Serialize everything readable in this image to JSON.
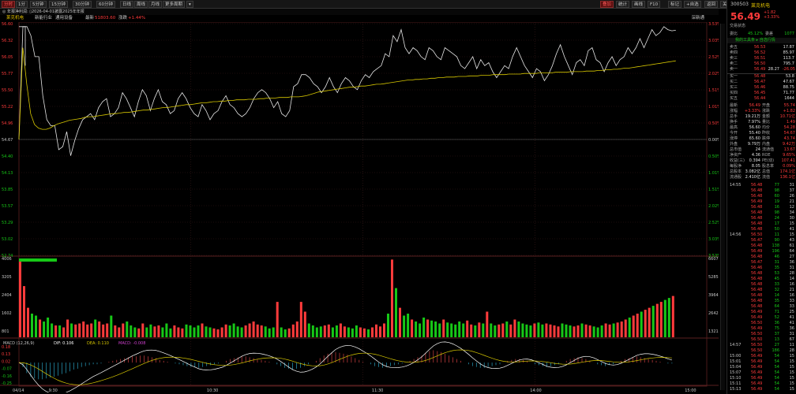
{
  "toolbar": {
    "left": [
      "分时",
      "1分",
      "5分钟",
      "15分钟",
      "30分钟",
      "60分钟",
      "日线",
      "周线",
      "月线",
      "更多周期",
      "▾"
    ],
    "right": [
      "叠加",
      "统计",
      "画线",
      "F10",
      "标记",
      "+自选",
      "返回",
      "关注",
      "经典",
      "指标"
    ],
    "active_right": "叠加"
  },
  "infobar": {
    "text": "◎  年报净利润: ▯2026-04-01披露2025年年报"
  },
  "legend": {
    "name": "莱克机电",
    "industry": "新能行业",
    "ind_extra": "通用设备",
    "latest_label": "最新",
    "latest": "51803.60",
    "change_label": "涨跌",
    "change": "+1.44%",
    "right_label": "深新通"
  },
  "colors": {
    "up": "#ff3b3b",
    "down": "#17c817",
    "price_line": "#e6e6e6",
    "avg_line": "#d8c800",
    "dif_line": "#ffffff",
    "dea_line": "#d8c800",
    "macd_up": "#d04040",
    "macd_down": "#28a0c0",
    "grid": "#3a1a1a"
  },
  "chart_data": [
    {
      "type": "line",
      "title": "",
      "y_left_ticks": [
        "56.60",
        "56.32",
        "56.05",
        "55.77",
        "55.50",
        "55.22",
        "54.96",
        "54.67",
        "54.40",
        "54.13",
        "53.85",
        "53.57",
        "53.29",
        "53.02",
        "52.74"
      ],
      "y_right_ticks": [
        "3.53%",
        "3.03%",
        "2.52%",
        "2.02%",
        "1.51%",
        "1.01%",
        "0.50%",
        "0.00%",
        "0.50%",
        "1.01%",
        "1.51%",
        "2.02%",
        "2.52%",
        "3.03%",
        "3.53%"
      ],
      "ylim": [
        52.74,
        56.6
      ],
      "prev_close": 54.67,
      "x_ticks": [
        "04/14",
        "9:30",
        "10:30",
        "11:30",
        "14:00",
        "15:00"
      ],
      "series": [
        {
          "name": "",
          "x_end_of_day_fraction": true,
          "values": [
            54.67,
            56.55,
            56.55,
            56.4,
            56.05,
            56.05,
            55.4,
            55.0,
            54.9,
            54.9,
            54.5,
            54.55,
            54.8,
            54.4,
            54.65,
            54.85,
            55.0,
            55.05,
            55.1,
            55.0,
            55.2,
            55.3,
            55.35,
            55.05,
            55.1,
            55.2,
            55.45,
            55.35,
            55.2,
            55.05,
            55.3,
            55.5,
            55.4,
            55.15,
            55.35,
            55.5,
            55.3,
            55.25,
            55.1,
            55.15,
            55.35,
            55.45,
            55.35,
            55.2,
            55.1,
            55.05,
            55.25,
            55.15,
            55.0,
            55.1,
            55.15,
            55.3,
            55.4,
            55.25,
            55.2,
            55.1,
            55.05,
            55.1,
            55.2,
            55.35,
            55.45,
            55.5,
            55.45,
            55.35,
            55.2,
            55.3,
            55.1,
            55.05,
            55.15,
            55.55,
            55.6,
            55.75,
            55.75,
            55.7,
            55.6,
            55.55,
            55.45,
            55.55,
            55.7,
            55.55,
            55.45,
            55.6,
            55.7,
            55.65,
            55.55,
            55.5,
            55.65,
            55.75,
            55.7,
            55.8,
            55.85,
            55.9,
            56.1,
            56.05,
            56.4,
            56.3,
            56.5,
            56.2,
            56.1,
            56.2,
            56.15,
            56.05,
            56.0,
            56.2,
            56.15,
            56.05,
            56.0,
            56.2,
            56.15,
            56.1,
            56.05,
            55.9,
            55.85,
            55.95,
            56.05,
            55.85,
            56.0,
            55.9,
            55.95,
            55.8,
            55.7,
            55.8,
            55.9,
            55.85,
            56.05,
            56.2,
            56.05,
            55.9,
            55.8,
            55.7,
            55.85,
            55.8,
            55.65,
            55.75,
            55.9,
            56.1,
            56.25,
            56.05,
            55.9,
            55.75,
            55.95,
            56.0,
            55.9,
            56.15,
            56.2,
            56.0,
            55.95,
            55.8,
            55.95,
            56.05,
            55.9,
            56.0,
            56.05,
            56.2,
            56.1,
            56.2,
            56.35,
            56.2,
            56.35,
            56.5,
            56.4,
            56.45,
            56.55,
            56.5,
            56.48,
            56.49
          ]
        },
        {
          "name": "",
          "values": [
            54.67,
            56.2,
            55.6,
            55.1,
            54.92,
            54.86,
            54.84,
            54.84,
            54.86,
            54.9,
            54.93,
            54.95,
            54.97,
            54.99,
            55.0,
            55.01,
            55.02,
            55.04,
            55.05,
            55.05,
            55.06,
            55.07,
            55.08,
            55.09,
            55.1,
            55.1,
            55.11,
            55.12,
            55.12,
            55.13,
            55.14,
            55.15,
            55.16,
            55.16,
            55.17,
            55.18,
            55.19,
            55.2,
            55.2,
            55.21,
            55.22,
            55.23,
            55.24,
            55.25,
            55.25,
            55.26,
            55.27,
            55.28,
            55.28,
            55.29,
            55.3,
            55.3,
            55.31,
            55.31,
            55.32,
            55.32,
            55.33,
            55.33,
            55.33,
            55.34,
            55.34,
            55.34,
            55.35,
            55.35,
            55.36,
            55.36,
            55.36,
            55.37,
            55.37,
            55.37,
            55.38,
            55.38,
            55.38,
            55.39,
            55.4,
            55.42,
            55.44,
            55.46,
            55.47,
            55.48,
            55.49,
            55.5,
            55.51,
            55.52,
            55.53,
            55.54,
            55.54,
            55.55,
            55.56,
            55.56,
            55.57,
            55.58,
            55.59,
            55.59,
            55.6,
            55.61,
            55.62,
            55.63,
            55.64,
            55.65,
            55.66,
            55.66,
            55.67,
            55.67,
            55.68,
            55.68,
            55.69,
            55.69,
            55.7,
            55.7,
            55.71,
            55.71,
            55.71,
            55.72,
            55.72,
            55.72,
            55.73,
            55.73,
            55.73,
            55.74,
            55.74,
            55.74,
            55.75,
            55.75,
            55.75,
            55.75,
            55.76,
            55.76,
            55.76,
            55.76,
            55.77,
            55.77,
            55.77,
            55.77,
            55.78,
            55.78,
            55.78,
            55.78,
            55.79,
            55.79,
            55.79,
            55.79,
            55.8,
            55.8,
            55.8,
            55.8,
            55.81,
            55.81,
            55.81,
            55.82,
            55.82,
            55.83,
            55.83,
            55.84,
            55.84,
            55.85,
            55.86,
            55.86,
            55.87,
            55.88,
            55.89,
            55.9,
            55.91,
            55.92,
            55.93,
            55.94,
            55.95,
            55.96,
            55.97,
            55.98
          ]
        }
      ]
    },
    {
      "type": "bar",
      "title": "",
      "y_left_ticks": [
        "4006",
        "3205",
        "2404",
        "1602",
        "801"
      ],
      "y_right_ticks": [
        "6607",
        "5285",
        "3964",
        "2642",
        "1321"
      ],
      "ylim": [
        0,
        4006
      ],
      "volume_bars": [
        4006,
        2600,
        1500,
        1200,
        1100,
        900,
        800,
        1000,
        700,
        600,
        600,
        500,
        900,
        700,
        650,
        700,
        800,
        650,
        700,
        900,
        800,
        650,
        700,
        1100,
        600,
        500,
        700,
        800,
        600,
        500,
        450,
        700,
        500,
        650,
        550,
        600,
        500,
        700,
        450,
        600,
        500,
        450,
        650,
        600,
        500,
        600,
        700,
        550,
        500,
        450,
        400,
        500,
        650,
        600,
        700,
        550,
        500,
        600,
        700,
        800,
        650,
        600,
        550,
        450,
        500,
        1800,
        500,
        400,
        450,
        650,
        800,
        1800,
        1300,
        700,
        600,
        500,
        550,
        600,
        650,
        500,
        600,
        700,
        550,
        500,
        450,
        600,
        500,
        450,
        400,
        500,
        650,
        550,
        700,
        1200,
        3950,
        2500,
        1500,
        1100,
        1200,
        900,
        800,
        700,
        1000,
        900,
        850,
        800,
        700,
        900,
        750,
        700,
        650,
        800,
        700,
        850,
        650,
        600,
        750,
        700,
        1300,
        700,
        600,
        650,
        700,
        800,
        650,
        900,
        800,
        700,
        650,
        600,
        700,
        750,
        650,
        700,
        650,
        600,
        550,
        700,
        650,
        600,
        550,
        600,
        700,
        650,
        600,
        550,
        500,
        600,
        700,
        650,
        700,
        750,
        800,
        900,
        1000,
        1100,
        1200,
        1300,
        1400,
        1500,
        1600,
        1700,
        1800,
        1900,
        2000,
        2100
      ]
    },
    {
      "type": "bar",
      "title": "MACD (12,26,9)",
      "labels": {
        "dif": "DIF: 0.106",
        "dea": "DEA: 0.110",
        "macd": "MACD: -0.008"
      },
      "y_left_ticks": [
        "0.18",
        "0.13",
        "0.02",
        "-0.07",
        "-0.16",
        "-0.25"
      ],
      "ylim": [
        -0.25,
        0.18
      ],
      "macd_values": [
        0.0,
        -0.05,
        -0.12,
        -0.16,
        -0.18,
        -0.19,
        -0.19,
        -0.18,
        -0.17,
        -0.16,
        -0.15,
        -0.13,
        -0.12,
        -0.1,
        -0.08,
        -0.07,
        -0.05,
        -0.04,
        -0.03,
        -0.02,
        -0.02,
        -0.01,
        0.0,
        0.01,
        0.02,
        0.03,
        0.04,
        0.05,
        0.06,
        0.07,
        0.07,
        0.08,
        0.08,
        0.07,
        0.06,
        0.05,
        0.03,
        0.02,
        0.01,
        0.0,
        -0.01,
        -0.02,
        -0.03,
        -0.04,
        -0.05,
        -0.05,
        -0.06,
        -0.05,
        -0.04,
        -0.03,
        -0.02,
        -0.01,
        0.0,
        0.02,
        0.04,
        0.05,
        0.06,
        0.07,
        0.07,
        0.06,
        0.05,
        0.04,
        0.03,
        0.02,
        0.01,
        0.0,
        -0.02,
        -0.04,
        -0.06,
        -0.07,
        -0.08,
        -0.07,
        -0.06,
        -0.04,
        -0.02,
        0.0,
        0.02,
        0.05,
        0.08,
        0.1,
        0.11,
        0.12,
        0.11,
        0.1,
        0.09,
        0.07,
        0.05,
        0.03,
        0.01,
        0.0,
        -0.02,
        -0.04,
        -0.05,
        -0.06,
        -0.05,
        -0.04,
        -0.03,
        -0.02,
        -0.01,
        0.0,
        0.02,
        0.04,
        0.06,
        0.08,
        0.11,
        0.13,
        0.14,
        0.13,
        0.12,
        0.1,
        0.08,
        0.06,
        0.04,
        0.02,
        0.0,
        -0.02,
        -0.04,
        -0.05,
        -0.06,
        -0.06,
        -0.05,
        -0.04,
        -0.03,
        -0.02,
        0.0,
        0.02,
        0.03,
        0.04,
        0.04,
        0.03,
        0.02,
        0.0,
        -0.02,
        -0.03,
        -0.04,
        -0.05,
        -0.04,
        -0.03,
        -0.02,
        0.0,
        0.02,
        0.04,
        0.05,
        0.06,
        0.05,
        0.04,
        0.02,
        0.0,
        -0.02,
        -0.03,
        -0.04,
        -0.03,
        -0.02,
        0.0,
        0.02,
        0.04,
        0.05,
        0.06,
        0.07,
        0.06,
        0.05,
        0.04,
        0.03,
        0.02,
        0.01,
        0.0,
        -0.01,
        -0.01
      ]
    }
  ],
  "sidebar": {
    "code": "300503",
    "name": "莱克机电",
    "price": "56.49",
    "change": "+1.82",
    "change_pct": "+3.33%",
    "section_title": "交易状态",
    "ratio_label": "委比",
    "ratio_val": "45.12%",
    "diff_label": "委差",
    "diff_val": "1077",
    "quote_title": "我的工具条 ▸ 自选行情",
    "asks": [
      {
        "l": "卖五",
        "p": "56.53",
        "v": "17.87"
      },
      {
        "l": "卖四",
        "p": "56.52",
        "v": "85.97"
      },
      {
        "l": "卖三",
        "p": "56.51",
        "v": "113.7"
      },
      {
        "l": "卖二",
        "p": "56.50",
        "v": "795.7"
      },
      {
        "l": "卖一",
        "p": "56.49",
        "v": "28.27",
        "x": "-26.05"
      }
    ],
    "bids": [
      {
        "l": "买一",
        "p": "56.48",
        "v": "53.8"
      },
      {
        "l": "买二",
        "p": "56.47",
        "v": "47.67"
      },
      {
        "l": "买三",
        "p": "56.46",
        "v": "88.75"
      },
      {
        "l": "买四",
        "p": "56.45",
        "v": "71.77"
      },
      {
        "l": "买五",
        "p": "56.44",
        "v": "1644"
      }
    ],
    "stats": [
      {
        "a": "最新",
        "av": "56.49",
        "b": "开盘",
        "bv": "55.74"
      },
      {
        "a": "涨幅",
        "av": "+3.33%",
        "b": "涨跌",
        "bv": "+1.82"
      },
      {
        "a": "总手",
        "av": "19.21万",
        "b": "金额",
        "bv": "10.71亿"
      },
      {
        "a": "换手",
        "av": "7.97%",
        "b": "量比",
        "bv": "1.49"
      },
      {
        "a": "最高",
        "av": "56.60",
        "b": "均价",
        "bv": "54.28"
      },
      {
        "a": "今开",
        "av": "55.40",
        "b": "昨收",
        "bv": "54.67"
      },
      {
        "a": "涨停",
        "av": "65.60",
        "b": "跌停",
        "bv": "43.74"
      },
      {
        "a": "外盘",
        "av": "9.79万",
        "b": "内盘",
        "bv": "9.42万"
      },
      {
        "a": "总市值",
        "av": "24",
        "b": "流通值",
        "bv": "13.67"
      },
      {
        "a": "净资产",
        "av": "4.36",
        "b": "ROE",
        "bv": "9.65%"
      },
      {
        "a": "收益(三)",
        "av": "0.394",
        "b": "PE(动)",
        "bv": "107.41"
      },
      {
        "a": "每股净",
        "av": "8.05",
        "b": "股息率",
        "bv": "0.09%"
      },
      {
        "a": "总股本",
        "av": "3.082亿",
        "b": "总值",
        "bv": "174.1亿"
      },
      {
        "a": "流通股",
        "av": "2.410亿",
        "b": "流值",
        "bv": "136.1亿"
      }
    ],
    "ticks": [
      {
        "t": "14:55",
        "p": "56.48",
        "v": "77",
        "d": "31"
      },
      {
        "t": "",
        "p": "56.48",
        "v": "98",
        "d": "37"
      },
      {
        "t": "",
        "p": "56.48",
        "v": "60",
        "d": "26"
      },
      {
        "t": "",
        "p": "56.49",
        "v": "19",
        "d": "21"
      },
      {
        "t": "",
        "p": "56.48",
        "v": "16",
        "d": "12"
      },
      {
        "t": "",
        "p": "56.48",
        "v": "98",
        "d": "34"
      },
      {
        "t": "",
        "p": "56.48",
        "v": "24",
        "d": "30"
      },
      {
        "t": "",
        "p": "56.48",
        "v": "17",
        "d": "15"
      },
      {
        "t": "",
        "p": "56.48",
        "v": "50",
        "d": "41"
      },
      {
        "t": "14:56",
        "p": "56.50",
        "v": "11",
        "d": "15"
      },
      {
        "t": "",
        "p": "56.47",
        "v": "90",
        "d": "43"
      },
      {
        "t": "",
        "p": "56.48",
        "v": "138",
        "d": "61"
      },
      {
        "t": "",
        "p": "56.49",
        "v": "196",
        "d": "64"
      },
      {
        "t": "",
        "p": "56.48",
        "v": "46",
        "d": "27"
      },
      {
        "t": "",
        "p": "56.47",
        "v": "31",
        "d": "36"
      },
      {
        "t": "",
        "p": "56.46",
        "v": "35",
        "d": "31"
      },
      {
        "t": "",
        "p": "56.48",
        "v": "53",
        "d": "28"
      },
      {
        "t": "",
        "p": "56.48",
        "v": "45",
        "d": "14"
      },
      {
        "t": "",
        "p": "56.48",
        "v": "33",
        "d": "16"
      },
      {
        "t": "",
        "p": "56.48",
        "v": "32",
        "d": "21"
      },
      {
        "t": "",
        "p": "56.48",
        "v": "14",
        "d": "16"
      },
      {
        "t": "",
        "p": "56.48",
        "v": "35",
        "d": "33"
      },
      {
        "t": "",
        "p": "56.48",
        "v": "64",
        "d": "33"
      },
      {
        "t": "",
        "p": "56.49",
        "v": "71",
        "d": "25"
      },
      {
        "t": "",
        "p": "56.49",
        "v": "52",
        "d": "41"
      },
      {
        "t": "",
        "p": "56.50",
        "v": "36",
        "d": "41"
      },
      {
        "t": "",
        "p": "56.49",
        "v": "75",
        "d": "36"
      },
      {
        "t": "",
        "p": "56.50",
        "v": "37",
        "d": "31"
      },
      {
        "t": "",
        "p": "56.50",
        "v": "13",
        "d": "67"
      },
      {
        "t": "14:57",
        "p": "56.50",
        "v": "27",
        "d": "11"
      },
      {
        "t": "",
        "p": "56.50",
        "v": "186",
        "d": "28"
      },
      {
        "t": "15:00",
        "p": "56.49",
        "v": "54",
        "d": "15"
      },
      {
        "t": "15:01",
        "p": "56.49",
        "v": "54",
        "d": "15"
      },
      {
        "t": "15:04",
        "p": "56.49",
        "v": "54",
        "d": "15"
      },
      {
        "t": "15:07",
        "p": "56.49",
        "v": "54",
        "d": "15"
      },
      {
        "t": "15:10",
        "p": "56.49",
        "v": "54",
        "d": "15"
      },
      {
        "t": "15:11",
        "p": "56.49",
        "v": "54",
        "d": "15"
      },
      {
        "t": "15:13",
        "p": "56.49",
        "v": "54",
        "d": "15"
      },
      {
        "t": "15:14",
        "p": "56.49",
        "v": "54",
        "d": "15"
      }
    ]
  }
}
